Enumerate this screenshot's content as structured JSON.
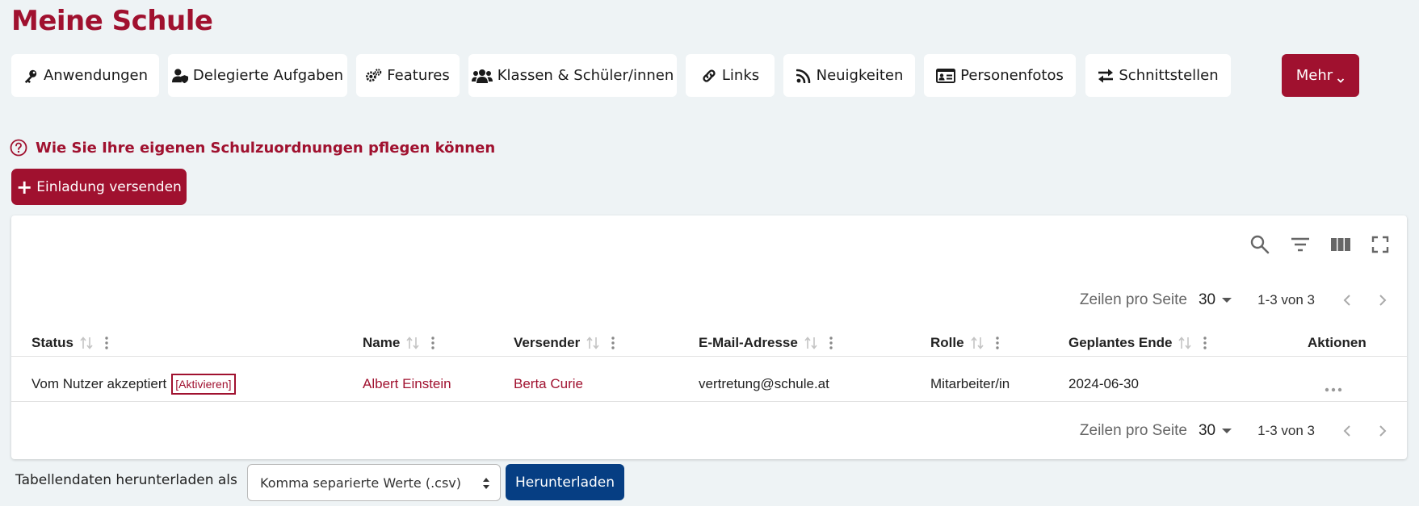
{
  "page": {
    "title": "Meine Schule"
  },
  "nav": {
    "items": [
      {
        "label": "Anwendungen",
        "icon": "key-icon"
      },
      {
        "label": "Delegierte Aufgaben",
        "icon": "user-shield-icon"
      },
      {
        "label": "Features",
        "icon": "gears-icon"
      },
      {
        "label": "Klassen & Schüler/innen",
        "icon": "users-icon"
      },
      {
        "label": "Links",
        "icon": "link-icon"
      },
      {
        "label": "Neuigkeiten",
        "icon": "rss-icon"
      },
      {
        "label": "Personenfotos",
        "icon": "id-card-icon"
      },
      {
        "label": "Schnittstellen",
        "icon": "exchange-icon"
      }
    ],
    "more_label": "Mehr"
  },
  "help": {
    "text": "Wie Sie Ihre eigenen Schulzuordnungen pflegen können"
  },
  "invite": {
    "label": "Einladung versenden"
  },
  "colors": {
    "brand": "#a0112f",
    "primary_button": "#063e83",
    "background": "#eef3f5"
  },
  "table": {
    "toolbar_icons": [
      "search-icon",
      "filter-icon",
      "columns-icon",
      "fullscreen-icon"
    ],
    "pager": {
      "rows_per_page_label": "Zeilen pro Seite",
      "rows_per_page": "30",
      "range": "1-3 von 3"
    },
    "columns": [
      "Status",
      "Name",
      "Versender",
      "E-Mail-Adresse",
      "Rolle",
      "Geplantes Ende",
      "Aktionen"
    ],
    "rows": [
      {
        "status": "Vom Nutzer akzeptiert",
        "status_action": "[Aktivieren]",
        "name": "Albert Einstein",
        "sender": "Berta Curie",
        "email": "vertretung@schule.at",
        "role": "Mitarbeiter/in",
        "planned_end": "2024-06-30"
      }
    ]
  },
  "download": {
    "label": "Tabellendaten herunterladen als",
    "format_selected": "Komma separierte Werte (.csv)",
    "button_label": "Herunterladen"
  }
}
